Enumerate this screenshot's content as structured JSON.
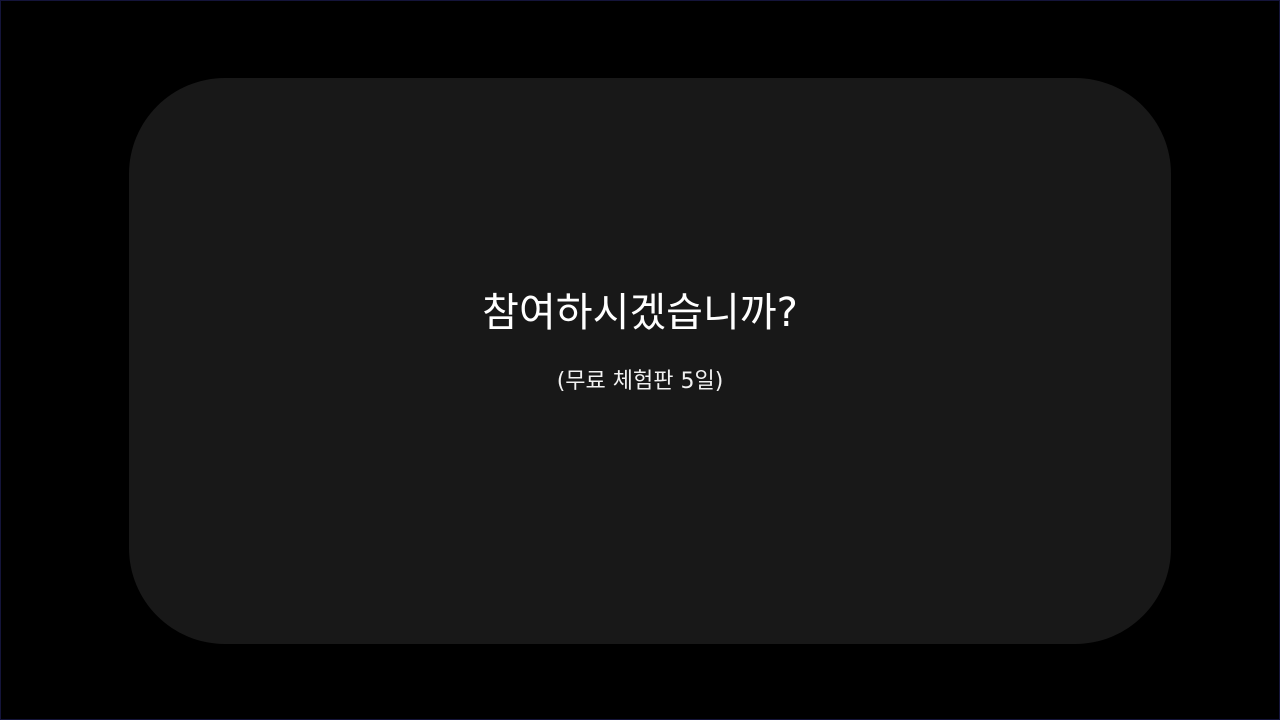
{
  "dialog": {
    "question": "참여하시겠습니까?",
    "subtitle": "(무료 체험판 5일)"
  },
  "colors": {
    "background": "#000000",
    "dialog_background": "#181818",
    "text": "#ffffff"
  }
}
